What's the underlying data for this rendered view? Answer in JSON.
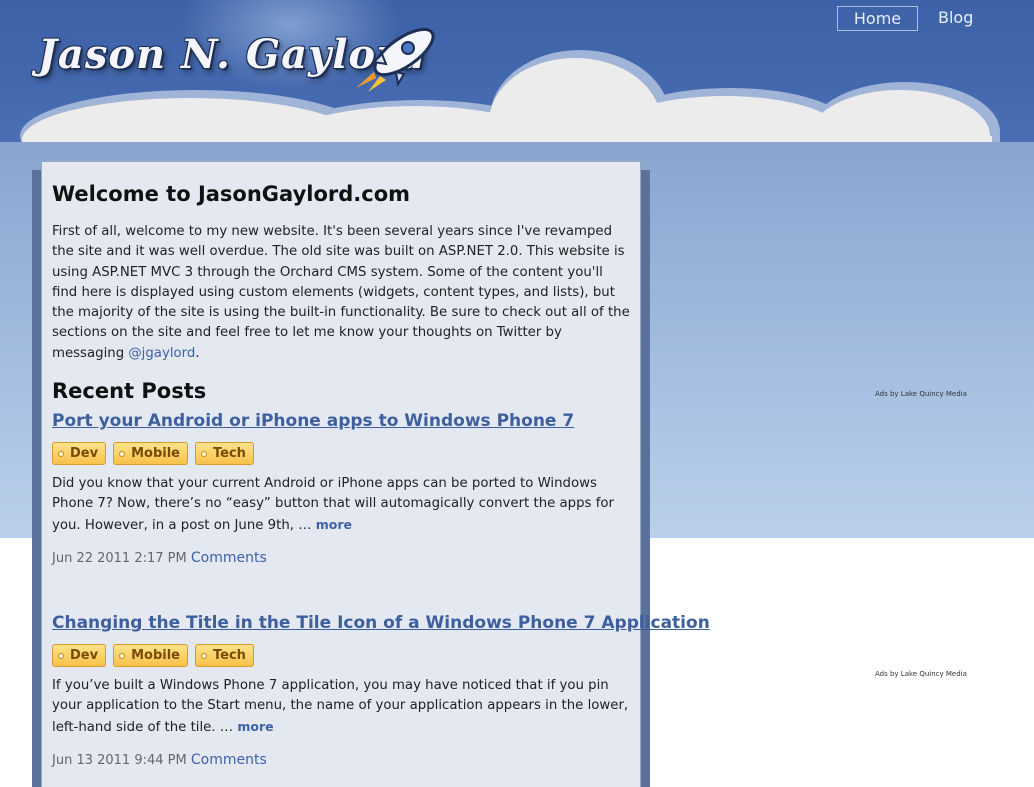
{
  "header": {
    "logo_text": "Jason N. Gaylord",
    "nav": [
      {
        "label": "Home",
        "active": true
      },
      {
        "label": "Blog",
        "active": false
      }
    ]
  },
  "main": {
    "welcome_title": "Welcome to JasonGaylord.com",
    "intro_text": "First of all, welcome to my new website. It's been several years since I've revamped the site and it was well overdue. The old site was built on ASP.NET 2.0. This website is using ASP.NET MVC 3 through the Orchard CMS system. Some of the content you'll find here is displayed using custom elements (widgets, content types, and lists), but the majority of the site is using the built-in functionality. Be sure to check out all of the sections on the site and feel free to let me know your thoughts on Twitter by messaging ",
    "twitter_handle": "@jgaylord",
    "intro_end": ".",
    "recent_posts_title": "Recent Posts",
    "posts": [
      {
        "title": "Port your Android or iPhone apps to Windows Phone 7",
        "tags": [
          "Dev",
          "Mobile",
          "Tech"
        ],
        "excerpt": "Did you know that your current Android or iPhone apps can be ported to Windows Phone 7? Now, there’s no “easy” button that will automagically convert the apps for you. However, in a post on June 9th, … ",
        "more_label": "more",
        "date": "Jun 22 2011 2:17 PM",
        "comments_label": "Comments"
      },
      {
        "title": "Changing the Title in the Tile Icon of a Windows Phone 7 Application",
        "tags": [
          "Dev",
          "Mobile",
          "Tech"
        ],
        "excerpt": "If you’ve built a Windows Phone 7 application, you may have noticed that if you pin your application to the Start menu, the name of your application appears in the lower, left-hand side of the tile. … ",
        "more_label": "more",
        "date": "Jun 13 2011 9:44 PM",
        "comments_label": "Comments"
      }
    ]
  },
  "sidebar": {
    "ads_label_1": "Ads by Lake Quincy Media",
    "ads_label_2": "Ads by Lake Quincy Media"
  },
  "colors": {
    "header_blue": "#4468ae",
    "link_blue": "#3e62a8",
    "panel_bg": "#e3e8f1",
    "tag_gold": "#f7c24a"
  }
}
